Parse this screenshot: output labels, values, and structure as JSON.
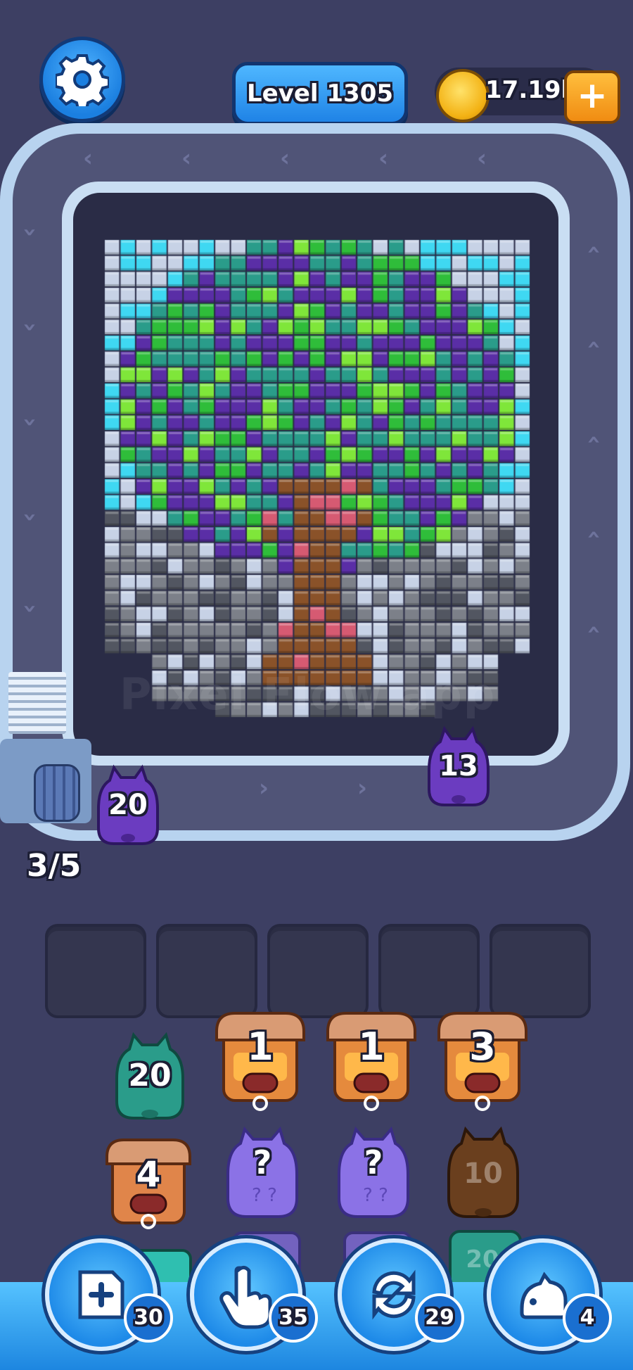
{
  "header": {
    "settings_icon": "gear-icon",
    "level_label": "Level 1305",
    "coins": "17.19k",
    "coin_icon": "coin-icon",
    "add_coins_icon": "plus-icon"
  },
  "board": {
    "watermark": "Pixel Flow app",
    "colors": {
      "cyan": "#3fd8f2",
      "light": "#c7d2e6",
      "teal": "#2a9c8a",
      "green": "#2fbd3a",
      "lime": "#7fe63a",
      "purple": "#5a2ea6",
      "gray": "#7c8089",
      "dark": "#525661",
      "brown": "#8a5229",
      "pink": "#d65a72"
    }
  },
  "conveyor": {
    "capacity": "3/5",
    "pigs_on_track": [
      {
        "label": "20",
        "color": "#6b3cc0"
      },
      {
        "label": "13",
        "color": "#6b3cc0"
      }
    ]
  },
  "slots": {
    "count": 5
  },
  "queue": {
    "pigs": [
      {
        "label": "20",
        "type": "pig",
        "color": "#2a9c8a"
      },
      {
        "label": "1",
        "type": "crate"
      },
      {
        "label": "1",
        "type": "crate"
      },
      {
        "label": "3",
        "type": "crate"
      },
      {
        "label": "4",
        "type": "crate"
      },
      {
        "label": "?",
        "type": "mystery",
        "color": "#8b72e6"
      },
      {
        "label": "?",
        "type": "mystery",
        "color": "#8b72e6"
      },
      {
        "label": "10",
        "type": "pig",
        "color": "#6a3f1e"
      },
      {
        "label": "20",
        "type": "pig",
        "color": "#2a9c8a"
      }
    ]
  },
  "tools": [
    {
      "name": "add-slot-icon",
      "count": "30"
    },
    {
      "name": "hand-pointer-icon",
      "count": "35"
    },
    {
      "name": "shuffle-icon",
      "count": "29"
    },
    {
      "name": "pig-vacuum-icon",
      "count": "4"
    }
  ]
}
